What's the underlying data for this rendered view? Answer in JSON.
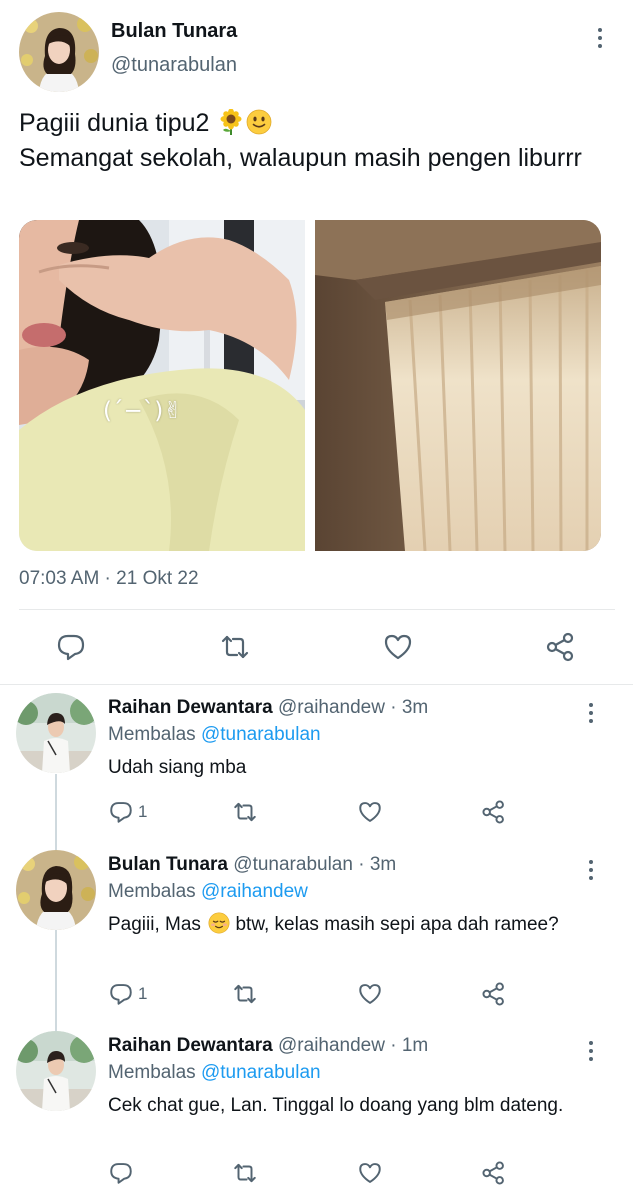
{
  "main_tweet": {
    "author_name": "Bulan Tunara",
    "author_handle": "@tunarabulan",
    "text_line1": "Pagiii dunia tipu2",
    "text_line2": "Semangat sekolah, walaupun masih pengen liburrr",
    "emoji_1": "sunflower-emoji",
    "emoji_2": "slightly-smiling-emoji",
    "photo_caption": "(´−`)✌",
    "timestamp": "07:03 AM · 21 Okt 22"
  },
  "replies": [
    {
      "name": "Raihan Dewantara",
      "meta": "@raihandew · 3m",
      "replying_prefix": "Membalas",
      "replying_to": "@tunarabulan",
      "text": "Udah siang mba",
      "reply_count": "1"
    },
    {
      "name": "Bulan Tunara",
      "meta": "@tunarabulan · 3m",
      "replying_prefix": "Membalas",
      "replying_to": "@raihandew",
      "text": "Pagiii, Mas",
      "text_after_emoji": " btw, kelas masih sepi apa dah ramee?",
      "emoji": "relieved-face-emoji",
      "reply_count": "1"
    },
    {
      "name": "Raihan Dewantara",
      "meta": "@raihandew · 1m",
      "replying_prefix": "Membalas",
      "replying_to": "@tunarabulan",
      "text": "Cek chat gue, Lan. Tinggal lo doang yang blm dateng.",
      "reply_count": ""
    }
  ],
  "icons": {
    "reply": "reply-icon",
    "retweet": "retweet-icon",
    "like": "like-icon",
    "share": "share-icon",
    "more": "more-vertical-icon"
  },
  "colors": {
    "text_primary": "#0f1419",
    "text_secondary": "#536471",
    "link": "#1d9bf0",
    "divider": "#e7e9ea"
  }
}
